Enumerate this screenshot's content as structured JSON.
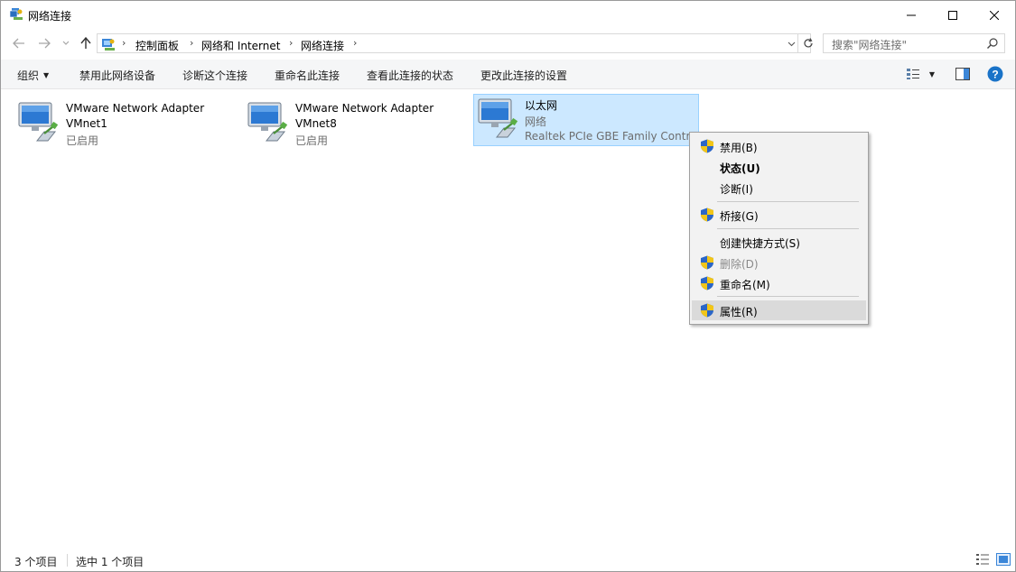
{
  "window": {
    "title": "网络连接",
    "title_icon": "network-connections-icon"
  },
  "address": {
    "breadcrumbs": [
      "控制面板",
      "网络和 Internet",
      "网络连接"
    ],
    "search_placeholder": "搜索\"网络连接\""
  },
  "toolbar": {
    "organize_label": "组织",
    "commands": [
      "禁用此网络设备",
      "诊断这个连接",
      "重命名此连接",
      "查看此连接的状态",
      "更改此连接的设置"
    ]
  },
  "items": [
    {
      "name": "VMware Network Adapter",
      "line2": "VMnet1",
      "line3": "已启用",
      "selected": false
    },
    {
      "name": "VMware Network Adapter",
      "line2": "VMnet8",
      "line3": "已启用",
      "selected": false
    },
    {
      "name": "以太网",
      "line2": "网络",
      "line3": "Realtek PCIe GBE Family Contr...",
      "selected": true
    }
  ],
  "context_menu": {
    "disable": "禁用(B)",
    "status": "状态(U)",
    "diagnose": "诊断(I)",
    "bridge": "桥接(G)",
    "create_shortcut": "创建快捷方式(S)",
    "delete": "删除(D)",
    "rename": "重命名(M)",
    "properties": "属性(R)"
  },
  "status": {
    "count": "3 个项目",
    "selected": "选中 1 个项目"
  },
  "colors": {
    "selection": "#cce8ff",
    "selection_border": "#99d1ff",
    "help": "#1a73c8",
    "shield_blue": "#2b66c7",
    "shield_yellow": "#f2c618"
  }
}
